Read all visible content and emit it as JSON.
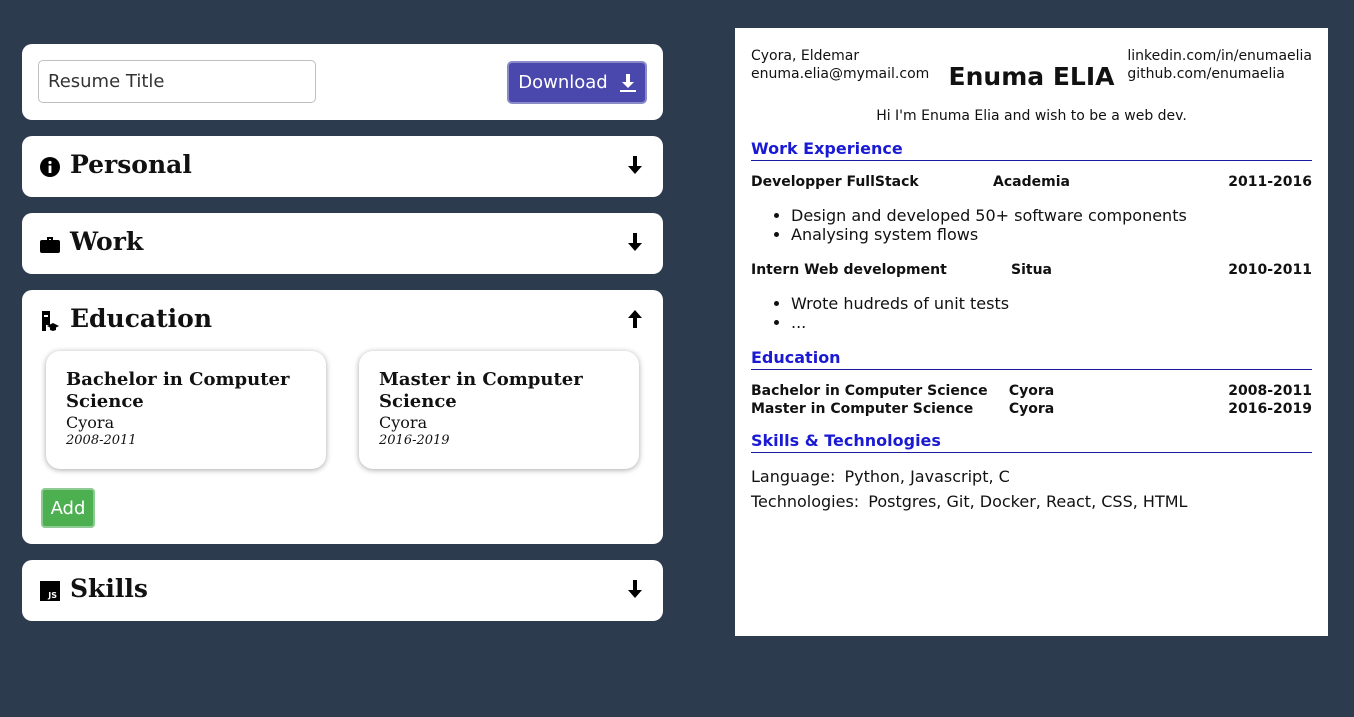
{
  "editor": {
    "title_placeholder": "Resume Title",
    "download_label": "Download",
    "sections": {
      "personal": {
        "title": "Personal",
        "icon": "info-icon",
        "state": "collapsed"
      },
      "work": {
        "title": "Work",
        "icon": "briefcase-icon",
        "state": "collapsed"
      },
      "education": {
        "title": "Education",
        "icon": "school-icon",
        "state": "expanded",
        "cards": [
          {
            "degree": "Bachelor in Computer Science",
            "school": "Cyora",
            "dates": "2008-2011"
          },
          {
            "degree": "Master in Computer Science",
            "school": "Cyora",
            "dates": "2016-2019"
          }
        ],
        "add_label": "Add"
      },
      "skills": {
        "title": "Skills",
        "icon": "js-icon",
        "state": "collapsed"
      }
    }
  },
  "resume": {
    "location": "Cyora, Eldemar",
    "email": "enuma.elia@mymail.com",
    "name": "Enuma ELIA",
    "linkedin": "linkedin.com/in/enumaelia",
    "github": "github.com/enumaelia",
    "summary": "Hi I'm Enuma Elia and wish to be a web dev.",
    "work_heading": "Work Experience",
    "work": [
      {
        "title": "Developper FullStack",
        "company": "Academia",
        "dates": "2011-2016",
        "bullets": [
          "Design and developed 50+ software components",
          "Analysing system flows"
        ]
      },
      {
        "title": "Intern Web development",
        "company": "Situa",
        "dates": "2010-2011",
        "bullets": [
          "Wrote hudreds of unit tests",
          "..."
        ]
      }
    ],
    "education_heading": "Education",
    "education": [
      {
        "degree": "Bachelor in Computer Science",
        "school": "Cyora",
        "dates": "2008-2011"
      },
      {
        "degree": "Master in Computer Science",
        "school": "Cyora",
        "dates": "2016-2019"
      }
    ],
    "skills_heading": "Skills & Technologies",
    "skills": [
      {
        "label": "Language:",
        "value": "Python, Javascript, C"
      },
      {
        "label": "Technologies:",
        "value": "Postgres, Git, Docker, React, CSS, HTML"
      }
    ]
  },
  "colors": {
    "background": "#2d3b4e",
    "download_button": "#4b48ad",
    "add_button": "#4caf50",
    "resume_heading": "#1a1ad4"
  }
}
